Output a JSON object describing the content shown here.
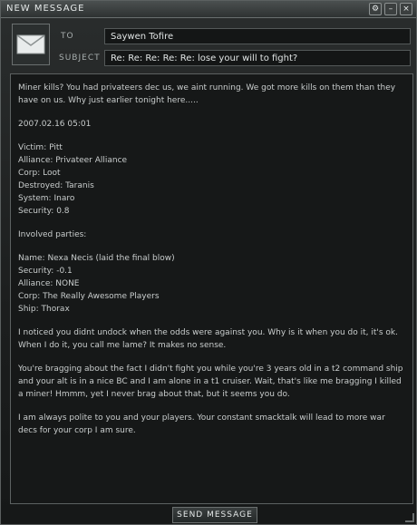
{
  "window": {
    "title": "NEW MESSAGE",
    "controls": [
      "settings-icon",
      "minimize-icon",
      "close-icon"
    ]
  },
  "header": {
    "to_label": "TO",
    "to_value": "Saywen Tofire",
    "subject_label": "SUBJECT",
    "subject_value": "Re: Re: Re: Re: Re: lose your will to fight?"
  },
  "message": {
    "paragraphs": [
      "Miner kills? You had privateers dec us, we aint running. We got more kills on them than they have on us. Why just earlier tonight here.....",
      "2007.02.16 05:01",
      "Victim: Pitt\nAlliance: Privateer Alliance\nCorp: Loot\nDestroyed: Taranis\nSystem: Inaro\nSecurity: 0.8",
      "Involved parties:",
      "Name: Nexa Necis (laid the final blow)\nSecurity: -0.1\nAlliance: NONE\nCorp: The Really Awesome Players\nShip: Thorax",
      "",
      "I noticed you didnt undock when the odds were against you. Why is it when you do it, it's ok. When I do it, you call me lame? It makes no sense.",
      "You're bragging about the fact I didn't fight you while you're 3 years old in a t2 command ship and your alt is in a nice BC and I am alone in a t1 cruiser. Wait, that's like me bragging I killed a miner! Hmmm, yet I never brag about that, but it seems you do.",
      "I am always polite to you and your players. Your constant smacktalk will lead to more war decs for your corp I am sure."
    ]
  },
  "footer": {
    "send_label": "SEND MESSAGE"
  }
}
